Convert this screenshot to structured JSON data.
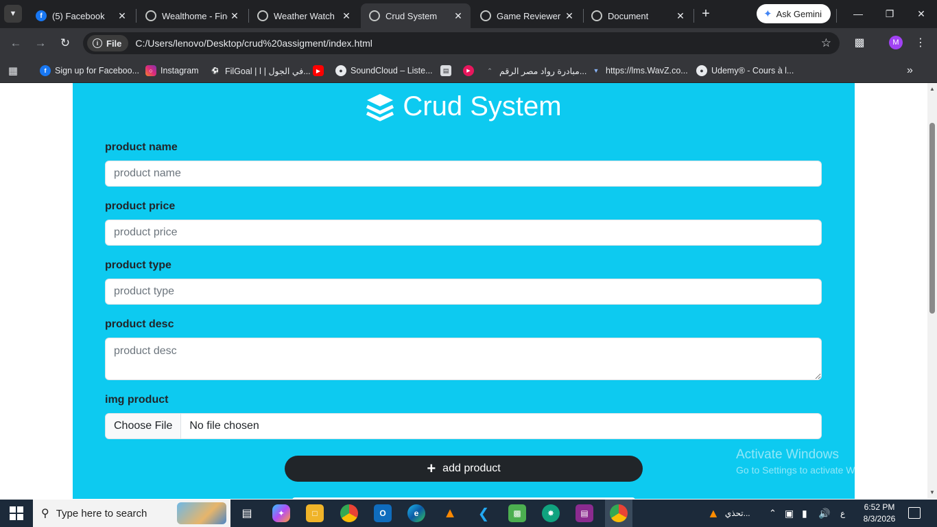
{
  "browser": {
    "tabs": [
      {
        "title": "(5) Facebook",
        "favicon": "facebook-icon",
        "active": false
      },
      {
        "title": "Wealthome - Finc",
        "favicon": "globe-icon",
        "active": false
      },
      {
        "title": "Weather Watch",
        "favicon": "globe-icon",
        "active": false
      },
      {
        "title": "Crud System",
        "favicon": "globe-icon",
        "active": true
      },
      {
        "title": "Game Reviewer",
        "favicon": "globe-icon",
        "active": false
      },
      {
        "title": "Document",
        "favicon": "globe-icon",
        "active": false
      }
    ],
    "gemini_label": "Ask Gemini",
    "address": {
      "scheme_chip": "File",
      "url": "C:/Users/lenovo/Desktop/crud%20assigment/index.html"
    },
    "profile_initial": "M",
    "bookmarks": [
      {
        "label": "Sign up for Faceboo...",
        "icon": "facebook-icon"
      },
      {
        "label": "Instagram",
        "icon": "instagram-icon"
      },
      {
        "label": "FilGoal | في الجول | ا...",
        "icon": "filgoal-icon"
      },
      {
        "label": "",
        "icon": "youtube-icon"
      },
      {
        "label": "SoundCloud – Liste...",
        "icon": "soundcloud-icon"
      },
      {
        "label": "",
        "icon": "document-icon"
      },
      {
        "label": "",
        "icon": "red-circle-icon"
      },
      {
        "label": "مبادرة رواد مصر الرقم...",
        "icon": "rowad-icon"
      },
      {
        "label": "https://lms.WavZ.co...",
        "icon": "lms-icon"
      },
      {
        "label": "Udemy® - Cours à l...",
        "icon": "globe-icon"
      }
    ]
  },
  "page": {
    "title": "Crud System",
    "title_icon": "layer-group-icon",
    "fields": {
      "name": {
        "label": "product name",
        "placeholder": "product name"
      },
      "price": {
        "label": "product price",
        "placeholder": "product price"
      },
      "type": {
        "label": "product type",
        "placeholder": "product type"
      },
      "desc": {
        "label": "product desc",
        "placeholder": "product desc"
      },
      "img": {
        "label": "img product",
        "button": "Choose File",
        "status": "No file chosen"
      }
    },
    "add_button": "add product",
    "colors": {
      "card_bg": "#0dcaf0",
      "button_bg": "#212529"
    }
  },
  "watermark": {
    "line1": "Activate Windows",
    "line2": "Go to Settings to activate Windows."
  },
  "taskbar": {
    "search_placeholder": "Type here to search",
    "tray_text": "تحذي...",
    "lang": "ع",
    "time": "6:52 PM",
    "date": "8/3/2026"
  }
}
